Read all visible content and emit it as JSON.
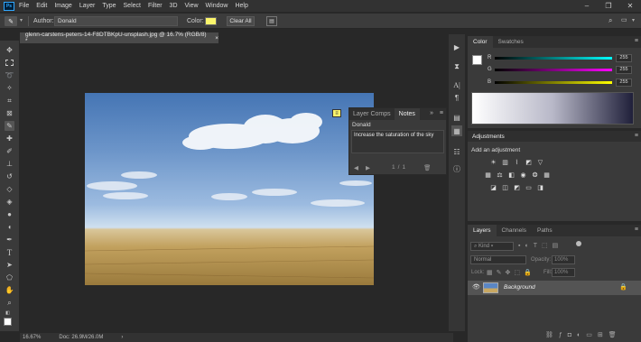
{
  "menubar": {
    "app_icon": "Ps",
    "items": [
      "File",
      "Edit",
      "Image",
      "Layer",
      "Type",
      "Select",
      "Filter",
      "3D",
      "View",
      "Window",
      "Help"
    ]
  },
  "window_controls": {
    "minimize": "–",
    "restore": "❐",
    "close": "✕"
  },
  "options_bar": {
    "author_label": "Author:",
    "author_value": "Donald",
    "color_label": "Color:",
    "note_color": "#fbf56b",
    "clear_all": "Clear All"
  },
  "document": {
    "tab_title": "glenn-carstens-peters-14-F8DTBKpU-unsplash.jpg @ 16.7% (RGB/8) *",
    "close": "×"
  },
  "status": {
    "zoom": "16.67%",
    "doc": "Doc: 26.9M/26.0M",
    "arrow": "›"
  },
  "notes_panel": {
    "tabs": [
      "Layer Comps",
      "Notes"
    ],
    "author": "Donald",
    "text": "Increase the  saturation of the sky",
    "page": "1",
    "sep": "/",
    "total": "1"
  },
  "color_panel": {
    "tabs": [
      "Color",
      "Swatches"
    ],
    "channels": [
      {
        "label": "R",
        "value": "255",
        "gradient": "#00ffff"
      },
      {
        "label": "G",
        "value": "255",
        "gradient": "#ff00ff"
      },
      {
        "label": "B",
        "value": "255",
        "gradient": "#ffff00"
      }
    ]
  },
  "adjustments_panel": {
    "title": "Adjustments",
    "add_label": "Add an adjustment"
  },
  "layers_panel": {
    "tabs": [
      "Layers",
      "Channels",
      "Paths"
    ],
    "kind": "Kind",
    "blend_mode": "Normal",
    "opacity_label": "Opacity:",
    "opacity_value": "100%",
    "lock_label": "Lock:",
    "fill_label": "Fill:",
    "fill_value": "100%",
    "layers": [
      {
        "name": "Background"
      }
    ]
  }
}
